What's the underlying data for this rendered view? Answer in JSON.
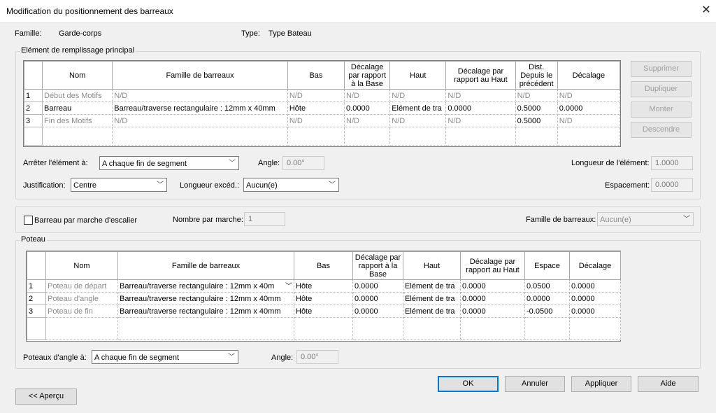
{
  "window": {
    "title": "Modification du positionnement des barreaux",
    "close_glyph": "✕"
  },
  "header": {
    "famille_label": "Famille:",
    "famille_value": "Garde-corps",
    "type_label": "Type:",
    "type_value": "Type Bateau"
  },
  "main": {
    "group_label": "Elément de remplissage principal",
    "columns": [
      "",
      "Nom",
      "Famille de barreaux",
      "Bas",
      "Décalage par rapport à la Base",
      "Haut",
      "Décalage par rapport au Haut",
      "Dist. Depuis le précédent",
      "Décalage"
    ],
    "rows": [
      {
        "num": "1",
        "nom": "Début des Motifs",
        "famille": "N/D",
        "bas": "N/D",
        "dec_base": "N/D",
        "haut": "N/D",
        "dec_haut": "N/D",
        "dist": "N/D",
        "decalage": "N/D"
      },
      {
        "num": "2",
        "nom": "Barreau",
        "famille": "Barreau/traverse rectangulaire : 12mm x 40mm",
        "bas": "Hôte",
        "dec_base": "0.0000",
        "haut": "Elément de tra",
        "dec_haut": "0.0000",
        "dist": "0.5000",
        "decalage": "0.0000"
      },
      {
        "num": "3",
        "nom": "Fin des Motifs",
        "famille": "N/D",
        "bas": "N/D",
        "dec_base": "N/D",
        "haut": "N/D",
        "dec_haut": "N/D",
        "dist": "0.5000",
        "decalage": "N/D"
      }
    ],
    "buttons": {
      "supprimer": "Supprimer",
      "dupliquer": "Dupliquer",
      "monter": "Monter",
      "descendre": "Descendre"
    },
    "arreter_label": "Arrêter l'élément à:",
    "arreter_value": "A chaque fin de segment",
    "angle_label": "Angle:",
    "angle_value": "0.00°",
    "longueur_label": "Longueur de l'élément:",
    "longueur_value": "1.0000",
    "justification_label": "Justification:",
    "justification_value": "Centre",
    "longueur_exced_label": "Longueur excéd.:",
    "longueur_exced_value": "Aucun(e)",
    "espacement_label": "Espacement:",
    "espacement_value": "0.0000"
  },
  "stair": {
    "checkbox_label": "Barreau par marche d'escalier",
    "nombre_label": "Nombre par marche:",
    "nombre_value": "1",
    "famille_label": "Famille de barreaux:",
    "famille_value": "Aucun(e)"
  },
  "poteau": {
    "group_label": "Poteau",
    "columns": [
      "",
      "Nom",
      "Famille de barreaux",
      "Bas",
      "Décalage par rapport à la Base",
      "Haut",
      "Décalage par rapport au Haut",
      "Espace",
      "Décalage"
    ],
    "rows": [
      {
        "num": "1",
        "nom": "Poteau de départ",
        "famille": "Barreau/traverse rectangulaire : 12mm x 40m",
        "bas": "Hôte",
        "dec_base": "0.0000",
        "haut": "Elément de tra",
        "dec_haut": "0.0000",
        "espace": "0.0500",
        "decalage": "0.0000"
      },
      {
        "num": "2",
        "nom": "Poteau d'angle",
        "famille": "Barreau/traverse rectangulaire : 12mm x 40mm",
        "bas": "Hôte",
        "dec_base": "0.0000",
        "haut": "Elément de tra",
        "dec_haut": "0.0000",
        "espace": "0.0000",
        "decalage": "0.0000"
      },
      {
        "num": "3",
        "nom": "Poteau de fin",
        "famille": "Barreau/traverse rectangulaire : 12mm x 40mm",
        "bas": "Hôte",
        "dec_base": "0.0000",
        "haut": "Elément de tra",
        "dec_haut": "0.0000",
        "espace": "-0.0500",
        "decalage": "0.0000"
      }
    ],
    "angle_pos_label": "Poteaux d'angle à:",
    "angle_pos_value": "A chaque fin de segment",
    "angle_label": "Angle:",
    "angle_value": "0.00°"
  },
  "footer": {
    "ok": "OK",
    "annuler": "Annuler",
    "appliquer": "Appliquer",
    "aide": "Aide",
    "apercu": "<< Aperçu"
  },
  "icons": {
    "dropdown": "chevron-down-icon",
    "close": "close-icon"
  }
}
